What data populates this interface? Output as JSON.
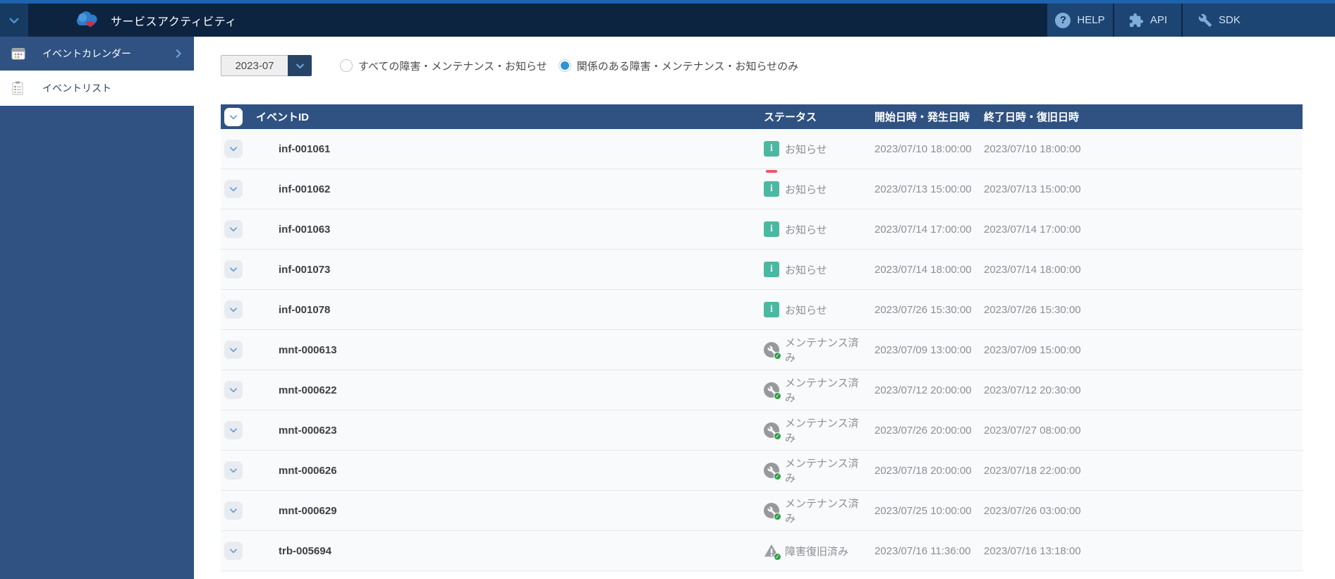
{
  "topbar": {
    "title": "サービスアクティビティ",
    "nav": [
      {
        "label": "HELP",
        "icon": "help-icon"
      },
      {
        "label": "API",
        "icon": "puzzle-icon"
      },
      {
        "label": "SDK",
        "icon": "wrench-icon"
      }
    ]
  },
  "sidebar": {
    "items": [
      {
        "label": "イベントカレンダー",
        "icon": "calendar-icon",
        "active": true,
        "has_submenu": true
      },
      {
        "label": "イベントリスト",
        "icon": "list-icon",
        "active": false,
        "has_submenu": false
      }
    ]
  },
  "filters": {
    "month": "2023-07",
    "radios": [
      {
        "label": "すべての障害・メンテナンス・お知らせ",
        "selected": false
      },
      {
        "label": "関係のある障害・メンテナンス・お知らせのみ",
        "selected": true
      }
    ]
  },
  "table": {
    "columns": [
      "イベントID",
      "ステータス",
      "開始日時・発生日時",
      "終了日時・復旧日時"
    ],
    "rows": [
      {
        "id": "inf-001061",
        "status": "お知らせ",
        "status_type": "info",
        "status_icon": "info-icon",
        "new": false,
        "start": "2023/07/10 18:00:00",
        "end": "2023/07/10 18:00:00"
      },
      {
        "id": "inf-001062",
        "status": "お知らせ",
        "status_type": "info",
        "status_icon": "info-icon",
        "new": true,
        "start": "2023/07/13 15:00:00",
        "end": "2023/07/13 15:00:00"
      },
      {
        "id": "inf-001063",
        "status": "お知らせ",
        "status_type": "info",
        "status_icon": "info-icon",
        "new": false,
        "start": "2023/07/14 17:00:00",
        "end": "2023/07/14 17:00:00"
      },
      {
        "id": "inf-001073",
        "status": "お知らせ",
        "status_type": "info",
        "status_icon": "info-icon",
        "new": false,
        "start": "2023/07/14 18:00:00",
        "end": "2023/07/14 18:00:00"
      },
      {
        "id": "inf-001078",
        "status": "お知らせ",
        "status_type": "info",
        "status_icon": "info-icon",
        "new": false,
        "start": "2023/07/26 15:30:00",
        "end": "2023/07/26 15:30:00"
      },
      {
        "id": "mnt-000613",
        "status": "メンテナンス済み",
        "status_type": "maintenance",
        "status_icon": "maintenance-check-icon",
        "new": false,
        "start": "2023/07/09 13:00:00",
        "end": "2023/07/09 15:00:00"
      },
      {
        "id": "mnt-000622",
        "status": "メンテナンス済み",
        "status_type": "maintenance",
        "status_icon": "maintenance-check-icon",
        "new": false,
        "start": "2023/07/12 20:00:00",
        "end": "2023/07/12 20:30:00"
      },
      {
        "id": "mnt-000623",
        "status": "メンテナンス済み",
        "status_type": "maintenance",
        "status_icon": "maintenance-check-icon",
        "new": false,
        "start": "2023/07/26 20:00:00",
        "end": "2023/07/27 08:00:00"
      },
      {
        "id": "mnt-000626",
        "status": "メンテナンス済み",
        "status_type": "maintenance",
        "status_icon": "maintenance-check-icon",
        "new": false,
        "start": "2023/07/18 20:00:00",
        "end": "2023/07/18 22:00:00"
      },
      {
        "id": "mnt-000629",
        "status": "メンテナンス済み",
        "status_type": "maintenance",
        "status_icon": "maintenance-check-icon",
        "new": false,
        "start": "2023/07/25 10:00:00",
        "end": "2023/07/26 03:00:00"
      },
      {
        "id": "trb-005694",
        "status": "障害復旧済み",
        "status_type": "trouble",
        "status_icon": "warning-check-icon",
        "new": false,
        "start": "2023/07/16 11:36:00",
        "end": "2023/07/16 13:18:00"
      }
    ]
  },
  "colors": {
    "topbar_navy": "#0d2441",
    "top_strip_blue": "#1d63ad",
    "panel_blue": "#2f5282",
    "nav_block_blue": "#1c4573",
    "accent_blue": "#6b9fd6",
    "radio_blue": "#2e95d3",
    "info_teal": "#4bb8a2",
    "check_green": "#2f9e44",
    "neutral_gray": "#97999c",
    "new_red": "#ef5660"
  }
}
